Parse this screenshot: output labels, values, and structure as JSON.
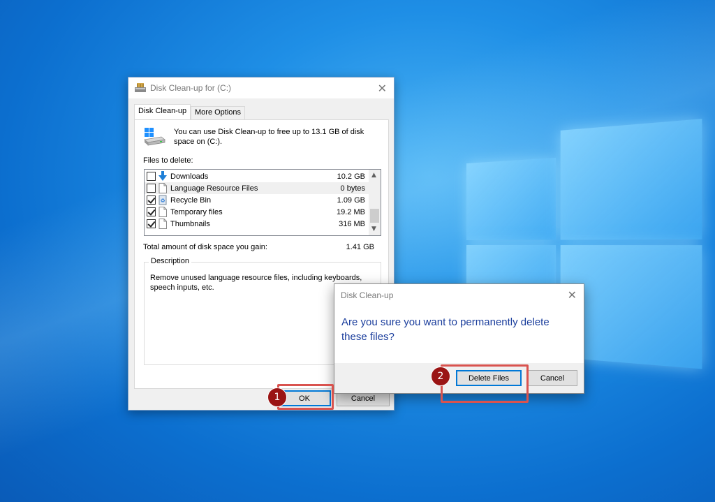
{
  "main_dialog": {
    "title": "Disk Clean-up for  (C:)",
    "tabs": [
      {
        "label": "Disk Clean-up",
        "active": true
      },
      {
        "label": "More Options",
        "active": false
      }
    ],
    "intro": "You can use Disk Clean-up to free up to 13.1 GB of disk space on  (C:).",
    "files_label": "Files to delete:",
    "files": [
      {
        "name": "Downloads",
        "size": "10.2 GB",
        "checked": false,
        "icon": "download-arrow-icon"
      },
      {
        "name": "Language Resource Files",
        "size": "0 bytes",
        "checked": false,
        "icon": "file-icon"
      },
      {
        "name": "Recycle Bin",
        "size": "1.09 GB",
        "checked": true,
        "icon": "recycle-bin-icon"
      },
      {
        "name": "Temporary files",
        "size": "19.2 MB",
        "checked": true,
        "icon": "file-icon"
      },
      {
        "name": "Thumbnails",
        "size": "316 MB",
        "checked": true,
        "icon": "file-icon"
      }
    ],
    "total_label": "Total amount of disk space you gain:",
    "total_value": "1.41 GB",
    "description_label": "Description",
    "description_text": "Remove unused language resource files, including keyboards, speech inputs, etc.",
    "ok_label": "OK",
    "cancel_label": "Cancel"
  },
  "confirm_dialog": {
    "title": "Disk Clean-up",
    "message": "Are you sure you want to permanently delete these files?",
    "delete_label": "Delete Files",
    "cancel_label": "Cancel"
  },
  "annotations": {
    "step1": "1",
    "step2": "2",
    "highlight_color": "#d9534f",
    "badge_color": "#9a1414"
  },
  "colors": {
    "accent": "#0078d7",
    "message_text": "#1a3d9c"
  }
}
